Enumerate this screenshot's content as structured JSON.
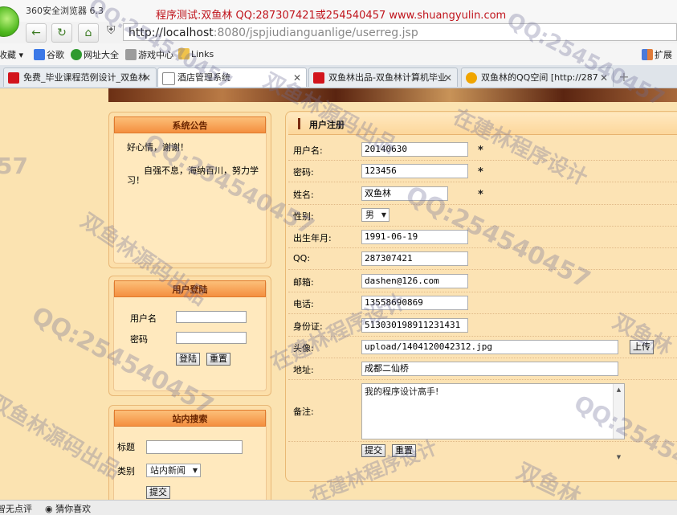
{
  "browser": {
    "app_title": "360安全浏览器 6.3",
    "ad_banner": "程序测试:双鱼林 QQ:287307421或254540457 www.shuangyulin.com",
    "url_host": "http://localhost",
    "url_rest": ":8080/jspjiudianguanlige/userreg.jsp",
    "bookmarks": [
      "收藏",
      "谷歌",
      "网址大全",
      "游戏中心",
      "Links"
    ],
    "extensions_label": "扩展",
    "tabs": [
      {
        "label": "免费_毕业课程范例设计_双鱼林",
        "color": "#d2141c"
      },
      {
        "label": "酒店管理系统",
        "color": "#888888"
      },
      {
        "label": "双鱼林出品-双鱼林计算机毕业",
        "color": "#d2141c"
      },
      {
        "label": "双鱼林的QQ空间 [http://287",
        "color": "#f0a500"
      }
    ],
    "status": [
      "智无点评",
      "猜你喜欢"
    ]
  },
  "notice": {
    "title": "系统公告",
    "line1": "好心情，谢谢！",
    "line2a": "自强不息，海纳百川，努力学",
    "line2b": "习！"
  },
  "login": {
    "title": "用户登陆",
    "username_label": "用户名",
    "password_label": "密码",
    "login_btn": "登陆",
    "reset_btn": "重置"
  },
  "search": {
    "title": "站内搜索",
    "title_label": "标题",
    "category_label": "类别",
    "category_value": "站内新闻",
    "submit_btn": "提交"
  },
  "reg": {
    "title": "用户注册",
    "required_mark": "*",
    "fields": {
      "username": {
        "label": "用户名:",
        "value": "20140630"
      },
      "password": {
        "label": "密码:",
        "value": "123456"
      },
      "name": {
        "label": "姓名:",
        "value": "双鱼林"
      },
      "gender": {
        "label": "性别:",
        "value": "男"
      },
      "birthday": {
        "label": "出生年月:",
        "value": "1991-06-19"
      },
      "qq": {
        "label": "QQ:",
        "value": "287307421"
      },
      "email": {
        "label": "邮箱:",
        "value": "dashen@126.com"
      },
      "phone": {
        "label": "电话:",
        "value": "13558690869"
      },
      "idcard": {
        "label": "身份证:",
        "value": "513030198911231431"
      },
      "avatar": {
        "label": "头像:",
        "value": "upload/1404120042312.jpg"
      },
      "address": {
        "label": "地址:",
        "value": "成都二仙桥"
      },
      "remark": {
        "label": "备注:",
        "value": "我的程序设计高手!"
      }
    },
    "upload_btn": "上传",
    "submit_btn": "提交",
    "reset_btn": "重置"
  },
  "watermarks": {
    "qq1": "QQ:254540457",
    "qq2": "QQ:254540457",
    "qq3": "QQ:254540457",
    "qq4": "QQ:254540457",
    "qq5": "QQ:254540457",
    "qq6": "QQ:25454",
    "qq7": "57",
    "source1": "双鱼林源码出品",
    "source2": "双鱼林源码出品",
    "source3": "双鱼林源码出品",
    "studio1": "在建林程序设计",
    "studio2": "在建林程序设计",
    "studio3": "在建林程序设计",
    "fish1": "双鱼林",
    "fish2": "双鱼林"
  }
}
